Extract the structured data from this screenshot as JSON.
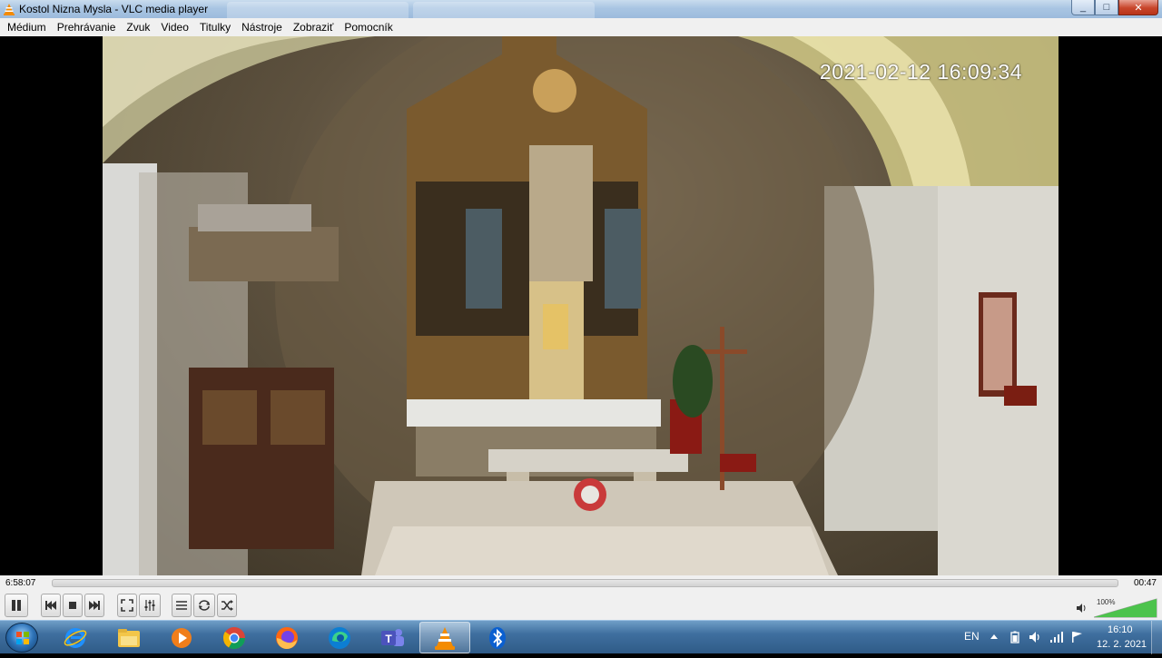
{
  "window": {
    "title": "Kostol Nizna Mysla - VLC media player",
    "minimize_glyph": "_",
    "maximize_glyph": "□",
    "close_glyph": "✕"
  },
  "menu": {
    "items": [
      "Médium",
      "Prehrávanie",
      "Zvuk",
      "Video",
      "Titulky",
      "Nástroje",
      "Zobraziť",
      "Pomocník"
    ]
  },
  "video": {
    "timestamp_overlay": "2021-02-12 16:09:34"
  },
  "seek": {
    "elapsed": "6:58:07",
    "remaining": "00:47"
  },
  "controls": {
    "volume_label": "100%",
    "volume_level": 1.0
  },
  "taskbar": {
    "apps": [
      "start-orb",
      "internet-explorer-icon",
      "file-explorer-icon",
      "media-player-icon",
      "chrome-icon",
      "firefox-icon",
      "edge-icon",
      "teams-icon",
      "vlc-icon",
      "bluetooth-icon"
    ],
    "active_app": "vlc-icon",
    "language": "EN",
    "clock_time": "16:10",
    "clock_date": "12. 2. 2021"
  },
  "colors": {
    "vlc_orange": "#f48b00",
    "volume_green": "#4cc34c",
    "taskbar_blue": "#3f6f9f"
  }
}
